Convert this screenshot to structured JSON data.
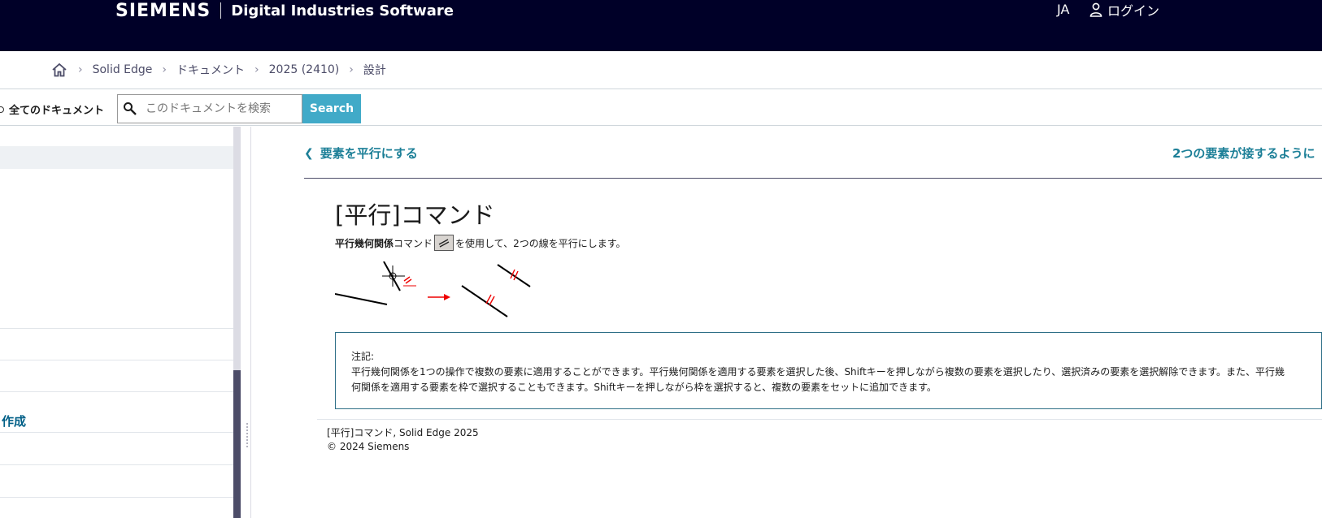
{
  "header": {
    "logo": "SIEMENS",
    "product": "Digital Industries Software",
    "language": "JA",
    "login_label": "ログイン",
    "background_color": "#000028"
  },
  "breadcrumb": {
    "home_icon": "home-icon",
    "items": [
      "Solid Edge",
      "ドキュメント",
      "2025 (2410)",
      "設計"
    ]
  },
  "search": {
    "scope_label": "全てのドキュメント",
    "placeholder": "このドキュメントを検索",
    "button_label": "Search",
    "button_color": "#41aac8"
  },
  "sidebar": {
    "visible_link": "作成"
  },
  "topic_nav": {
    "prev_label": "要素を平行にする",
    "next_label": "2つの要素が接するように"
  },
  "article": {
    "title": "[平行]コマンド",
    "desc_bold": "平行幾何関係",
    "desc_mid": "コマンド",
    "desc_tail": "を使用して、2つの線を平行にします。",
    "command_icon": "parallel-command-icon",
    "note_heading": "注記:",
    "note_text": "平行幾何関係を1つの操作で複数の要素に適用することができます。平行幾何関係を適用する要素を選択した後、Shiftキーを押しながら複数の要素を選択したり、選択済みの要素を選択解除できます。また、平行幾何関係を適用する要素を枠で選択することもできます。Shiftキーを押しながら枠を選択すると、複数の要素をセットに追加できます。"
  },
  "footer": {
    "line1": "[平行]コマンド, Solid Edge 2025",
    "line2": "© 2024 Siemens"
  }
}
